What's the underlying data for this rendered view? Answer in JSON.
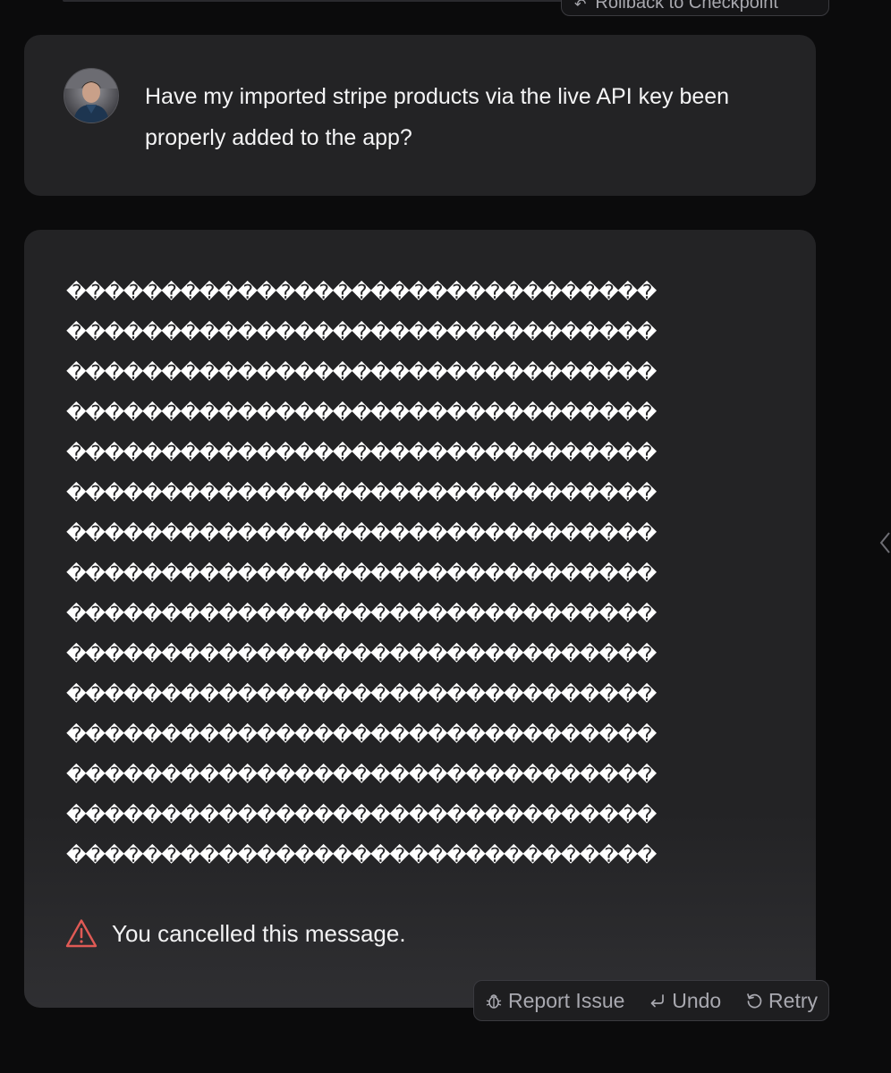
{
  "header": {
    "rollback_label": "Rollback to Checkpoint"
  },
  "user_message": {
    "text": "Have my imported stripe products via the live API key been properly added to the app?"
  },
  "assistant_message": {
    "garbled_lines": [
      "�������������������������������",
      "�������������������������������",
      "�������������������������������",
      "�������������������������������",
      "�������������������������������",
      "�������������������������������",
      "�������������������������������",
      "�������������������������������",
      "�������������������������������",
      "�������������������������������",
      "�������������������������������",
      "�������������������������������",
      "�������������������������������",
      "�������������������������������",
      "�������������������������������"
    ],
    "cancel_notice": "You cancelled this message."
  },
  "actions": {
    "report_issue_label": "Report Issue",
    "undo_label": "Undo",
    "retry_label": "Retry"
  },
  "colors": {
    "background": "#0b0b0c",
    "card": "#232325",
    "warning": "#e05a55",
    "muted_text": "#a9a9b0"
  },
  "icons": {
    "rollback": "rollback-icon",
    "warning": "warning-triangle-icon",
    "report": "bug-icon",
    "undo": "undo-arrow-icon",
    "retry": "retry-icon",
    "side": "chevron-left-icon"
  }
}
